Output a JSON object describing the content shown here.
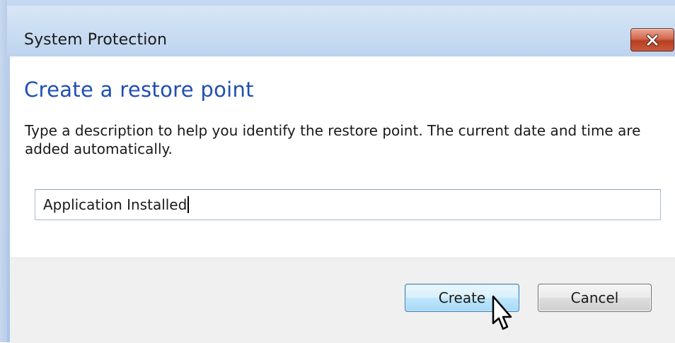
{
  "window": {
    "title": "System Protection",
    "close_icon": "close-x-icon"
  },
  "main": {
    "heading": "Create a restore point",
    "description": "Type a description to help you identify the restore point. The current date and time are added automatically.",
    "input_value": "Application Installed",
    "input_placeholder": ""
  },
  "footer": {
    "create_label": "Create",
    "cancel_label": "Cancel"
  },
  "colors": {
    "heading": "#1f4fb2",
    "close_button": "#c9502f",
    "create_border": "#3c7fb1"
  },
  "cursor_icon": "mouse-pointer-icon"
}
